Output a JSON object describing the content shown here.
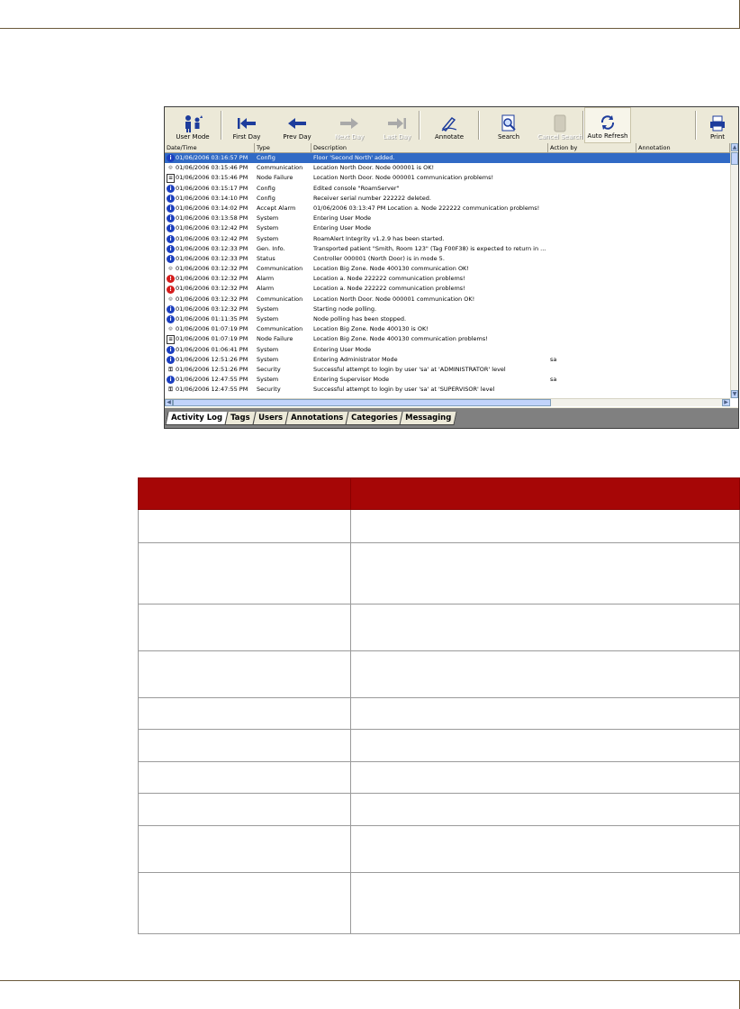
{
  "toolbar": {
    "buttons": [
      {
        "label": "User Mode",
        "icon": "user-mode-icon",
        "enabled": true
      },
      {
        "label": "First Day",
        "icon": "first-day-icon",
        "enabled": true
      },
      {
        "label": "Prev Day",
        "icon": "prev-day-icon",
        "enabled": true
      },
      {
        "label": "Next Day",
        "icon": "next-day-icon",
        "enabled": false
      },
      {
        "label": "Last Day",
        "icon": "last-day-icon",
        "enabled": false
      },
      {
        "label": "Annotate",
        "icon": "annotate-icon",
        "enabled": true
      },
      {
        "label": "Search",
        "icon": "search-icon",
        "enabled": true
      },
      {
        "label": "Cancel Search",
        "icon": "cancel-search-icon",
        "enabled": false
      },
      {
        "label": "Auto Refresh",
        "icon": "auto-refresh-icon",
        "enabled": true,
        "active": true
      },
      {
        "label": "Print",
        "icon": "print-icon",
        "enabled": true
      }
    ]
  },
  "grid": {
    "columns": [
      "Date/Time",
      "Type",
      "Description",
      "Action by",
      "Annotation"
    ],
    "rows": [
      {
        "icon": "info",
        "datetime": "01/06/2006 03:16:57 PM",
        "type": "Config",
        "description": "Floor 'Second North' added.",
        "action_by": "",
        "annotation": ""
      },
      {
        "icon": "comm",
        "datetime": "01/06/2006 03:15:46 PM",
        "type": "Communication",
        "description": "Location North Door. Node 000001 is OK!",
        "action_by": "",
        "annotation": ""
      },
      {
        "icon": "fail",
        "datetime": "01/06/2006 03:15:46 PM",
        "type": "Node Failure",
        "description": "Location North Door. Node 000001 communication problems!",
        "action_by": "",
        "annotation": ""
      },
      {
        "icon": "info",
        "datetime": "01/06/2006 03:15:17 PM",
        "type": "Config",
        "description": "Edited console \"RoamServer\"",
        "action_by": "",
        "annotation": ""
      },
      {
        "icon": "info",
        "datetime": "01/06/2006 03:14:10 PM",
        "type": "Config",
        "description": "Receiver serial number 222222 deleted.",
        "action_by": "",
        "annotation": ""
      },
      {
        "icon": "info",
        "datetime": "01/06/2006 03:14:02 PM",
        "type": "Accept Alarm",
        "description": "01/06/2006 03:13:47 PM Location a. Node 222222 communication problems!",
        "action_by": "",
        "annotation": ""
      },
      {
        "icon": "info",
        "datetime": "01/06/2006 03:13:58 PM",
        "type": "System",
        "description": "Entering User Mode",
        "action_by": "",
        "annotation": ""
      },
      {
        "icon": "info",
        "datetime": "01/06/2006 03:12:42 PM",
        "type": "System",
        "description": "Entering User Mode",
        "action_by": "",
        "annotation": ""
      },
      {
        "icon": "info",
        "datetime": "01/06/2006 03:12:42 PM",
        "type": "System",
        "description": "RoamAlert Integrity v1.2.9 has been started.",
        "action_by": "",
        "annotation": ""
      },
      {
        "icon": "info",
        "datetime": "01/06/2006 03:12:33 PM",
        "type": "Gen. Info.",
        "description": "Transported patient \"Smith, Room 123\" (Tag F00F38) is expected to return in ...",
        "action_by": "",
        "annotation": ""
      },
      {
        "icon": "info",
        "datetime": "01/06/2006 03:12:33 PM",
        "type": "Status",
        "description": "Controller 000001 (North Door) is in mode 5.",
        "action_by": "",
        "annotation": ""
      },
      {
        "icon": "comm",
        "datetime": "01/06/2006 03:12:32 PM",
        "type": "Communication",
        "description": "Location Big Zone. Node 400130 communication OK!",
        "action_by": "",
        "annotation": ""
      },
      {
        "icon": "alarm",
        "datetime": "01/06/2006 03:12:32 PM",
        "type": "Alarm",
        "description": "Location a. Node 222222 communication problems!",
        "action_by": "",
        "annotation": ""
      },
      {
        "icon": "alarm",
        "datetime": "01/06/2006 03:12:32 PM",
        "type": "Alarm",
        "description": "Location a. Node 222222 communication problems!",
        "action_by": "",
        "annotation": ""
      },
      {
        "icon": "comm",
        "datetime": "01/06/2006 03:12:32 PM",
        "type": "Communication",
        "description": "Location North Door. Node 000001 communication OK!",
        "action_by": "",
        "annotation": ""
      },
      {
        "icon": "info",
        "datetime": "01/06/2006 03:12:32 PM",
        "type": "System",
        "description": "Starting node polling.",
        "action_by": "",
        "annotation": ""
      },
      {
        "icon": "info",
        "datetime": "01/06/2006 01:11:35 PM",
        "type": "System",
        "description": "Node polling has been stopped.",
        "action_by": "",
        "annotation": ""
      },
      {
        "icon": "comm",
        "datetime": "01/06/2006 01:07:19 PM",
        "type": "Communication",
        "description": "Location Big Zone. Node 400130 is OK!",
        "action_by": "",
        "annotation": ""
      },
      {
        "icon": "fail",
        "datetime": "01/06/2006 01:07:19 PM",
        "type": "Node Failure",
        "description": "Location Big Zone. Node 400130 communication problems!",
        "action_by": "",
        "annotation": ""
      },
      {
        "icon": "info",
        "datetime": "01/06/2006 01:06:41 PM",
        "type": "System",
        "description": "Entering User Mode",
        "action_by": "",
        "annotation": ""
      },
      {
        "icon": "info",
        "datetime": "01/06/2006 12:51:26 PM",
        "type": "System",
        "description": "Entering Administrator Mode",
        "action_by": "sa",
        "annotation": ""
      },
      {
        "icon": "sec",
        "datetime": "01/06/2006 12:51:26 PM",
        "type": "Security",
        "description": "Successful attempt to login by user 'sa' at 'ADMINISTRATOR' level",
        "action_by": "",
        "annotation": ""
      },
      {
        "icon": "info",
        "datetime": "01/06/2006 12:47:55 PM",
        "type": "System",
        "description": "Entering Supervisor Mode",
        "action_by": "sa",
        "annotation": ""
      },
      {
        "icon": "sec",
        "datetime": "01/06/2006 12:47:55 PM",
        "type": "Security",
        "description": "Successful attempt to login by user 'sa' at 'SUPERVISOR' level",
        "action_by": "",
        "annotation": ""
      }
    ],
    "selected_index": 0
  },
  "tabs": [
    "Activity Log",
    "Tags",
    "Users",
    "Annotations",
    "Categories",
    "Messaging"
  ],
  "active_tab": 0,
  "desc_table": {
    "rows": 10
  },
  "colors": {
    "table_header": "#a60606",
    "selection": "#316ac5",
    "window_bg": "#ece9d8"
  }
}
